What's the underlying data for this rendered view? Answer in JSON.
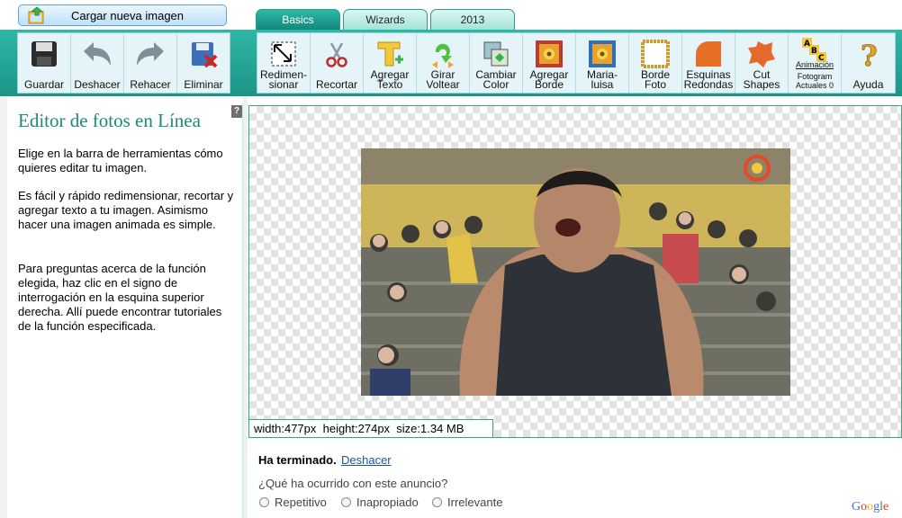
{
  "header": {
    "upload_label": "Cargar nueva imagen",
    "tabs": [
      {
        "label": "Basics",
        "active": true
      },
      {
        "label": "Wizards",
        "active": false
      },
      {
        "label": "2013",
        "active": false
      }
    ]
  },
  "toolbar": {
    "file_tools": [
      {
        "label": "Guardar",
        "icon": "save-icon"
      },
      {
        "label": "Deshacer",
        "icon": "undo-icon"
      },
      {
        "label": "Rehacer",
        "icon": "redo-icon"
      },
      {
        "label": "Eliminar",
        "icon": "delete-icon"
      }
    ],
    "edit_tools": [
      {
        "label": "Redimen-\nsionar",
        "icon": "resize-icon"
      },
      {
        "label": "Recortar",
        "icon": "scissors-icon"
      },
      {
        "label": "Agregar\nTexto",
        "icon": "text-icon"
      },
      {
        "label": "Girar\nVoltear",
        "icon": "rotate-icon"
      },
      {
        "label": "Cambiar\nColor",
        "icon": "color-icon"
      },
      {
        "label": "Agregar\nBorde",
        "icon": "border-icon"
      },
      {
        "label": "Maria-\nluisa",
        "icon": "passepartout-icon"
      },
      {
        "label": "Borde\nFoto",
        "icon": "photo-frame-icon"
      },
      {
        "label": "Esquinas\nRedondas",
        "icon": "rounded-corners-icon"
      },
      {
        "label": "Cut\nShapes",
        "icon": "cut-shapes-icon"
      },
      {
        "label": "Animación",
        "sublabel": "Fotogram\nActuales 0",
        "icon": "animation-icon",
        "icon_text": "ABC"
      },
      {
        "label": "Ayuda",
        "icon": "help-icon",
        "icon_text": "?"
      }
    ]
  },
  "left_panel": {
    "help_icon_text": "?",
    "title": "Editor de fotos en Línea",
    "paragraphs": [
      "Elige en la barra de herramientas cómo quieres editar tu imagen.",
      "Es fácil y rápido redimensionar, recortar y agregar texto a tu imagen. Asimismo hacer una imagen animada es simple.",
      "Para preguntas acerca de la función elegida, haz clic en el signo de interrogación en la esquina superior derecha. Allí puede encontrar tutoriales de la función especificada."
    ]
  },
  "canvas": {
    "info": "width:477px  height:274px  size:1.34 MB"
  },
  "ad_feedback": {
    "done": "Ha terminado.",
    "undo_link": "Deshacer",
    "question": "¿Qué ha ocurrido con este anuncio?",
    "options": [
      "Repetitivo",
      "Inapropiado",
      "Irrelevante"
    ],
    "brand": "Google"
  },
  "colors": {
    "toolbar": "#1f9d8e",
    "tab_active": "#13857a",
    "title": "#1a8a7c",
    "link": "#1a52b5"
  }
}
